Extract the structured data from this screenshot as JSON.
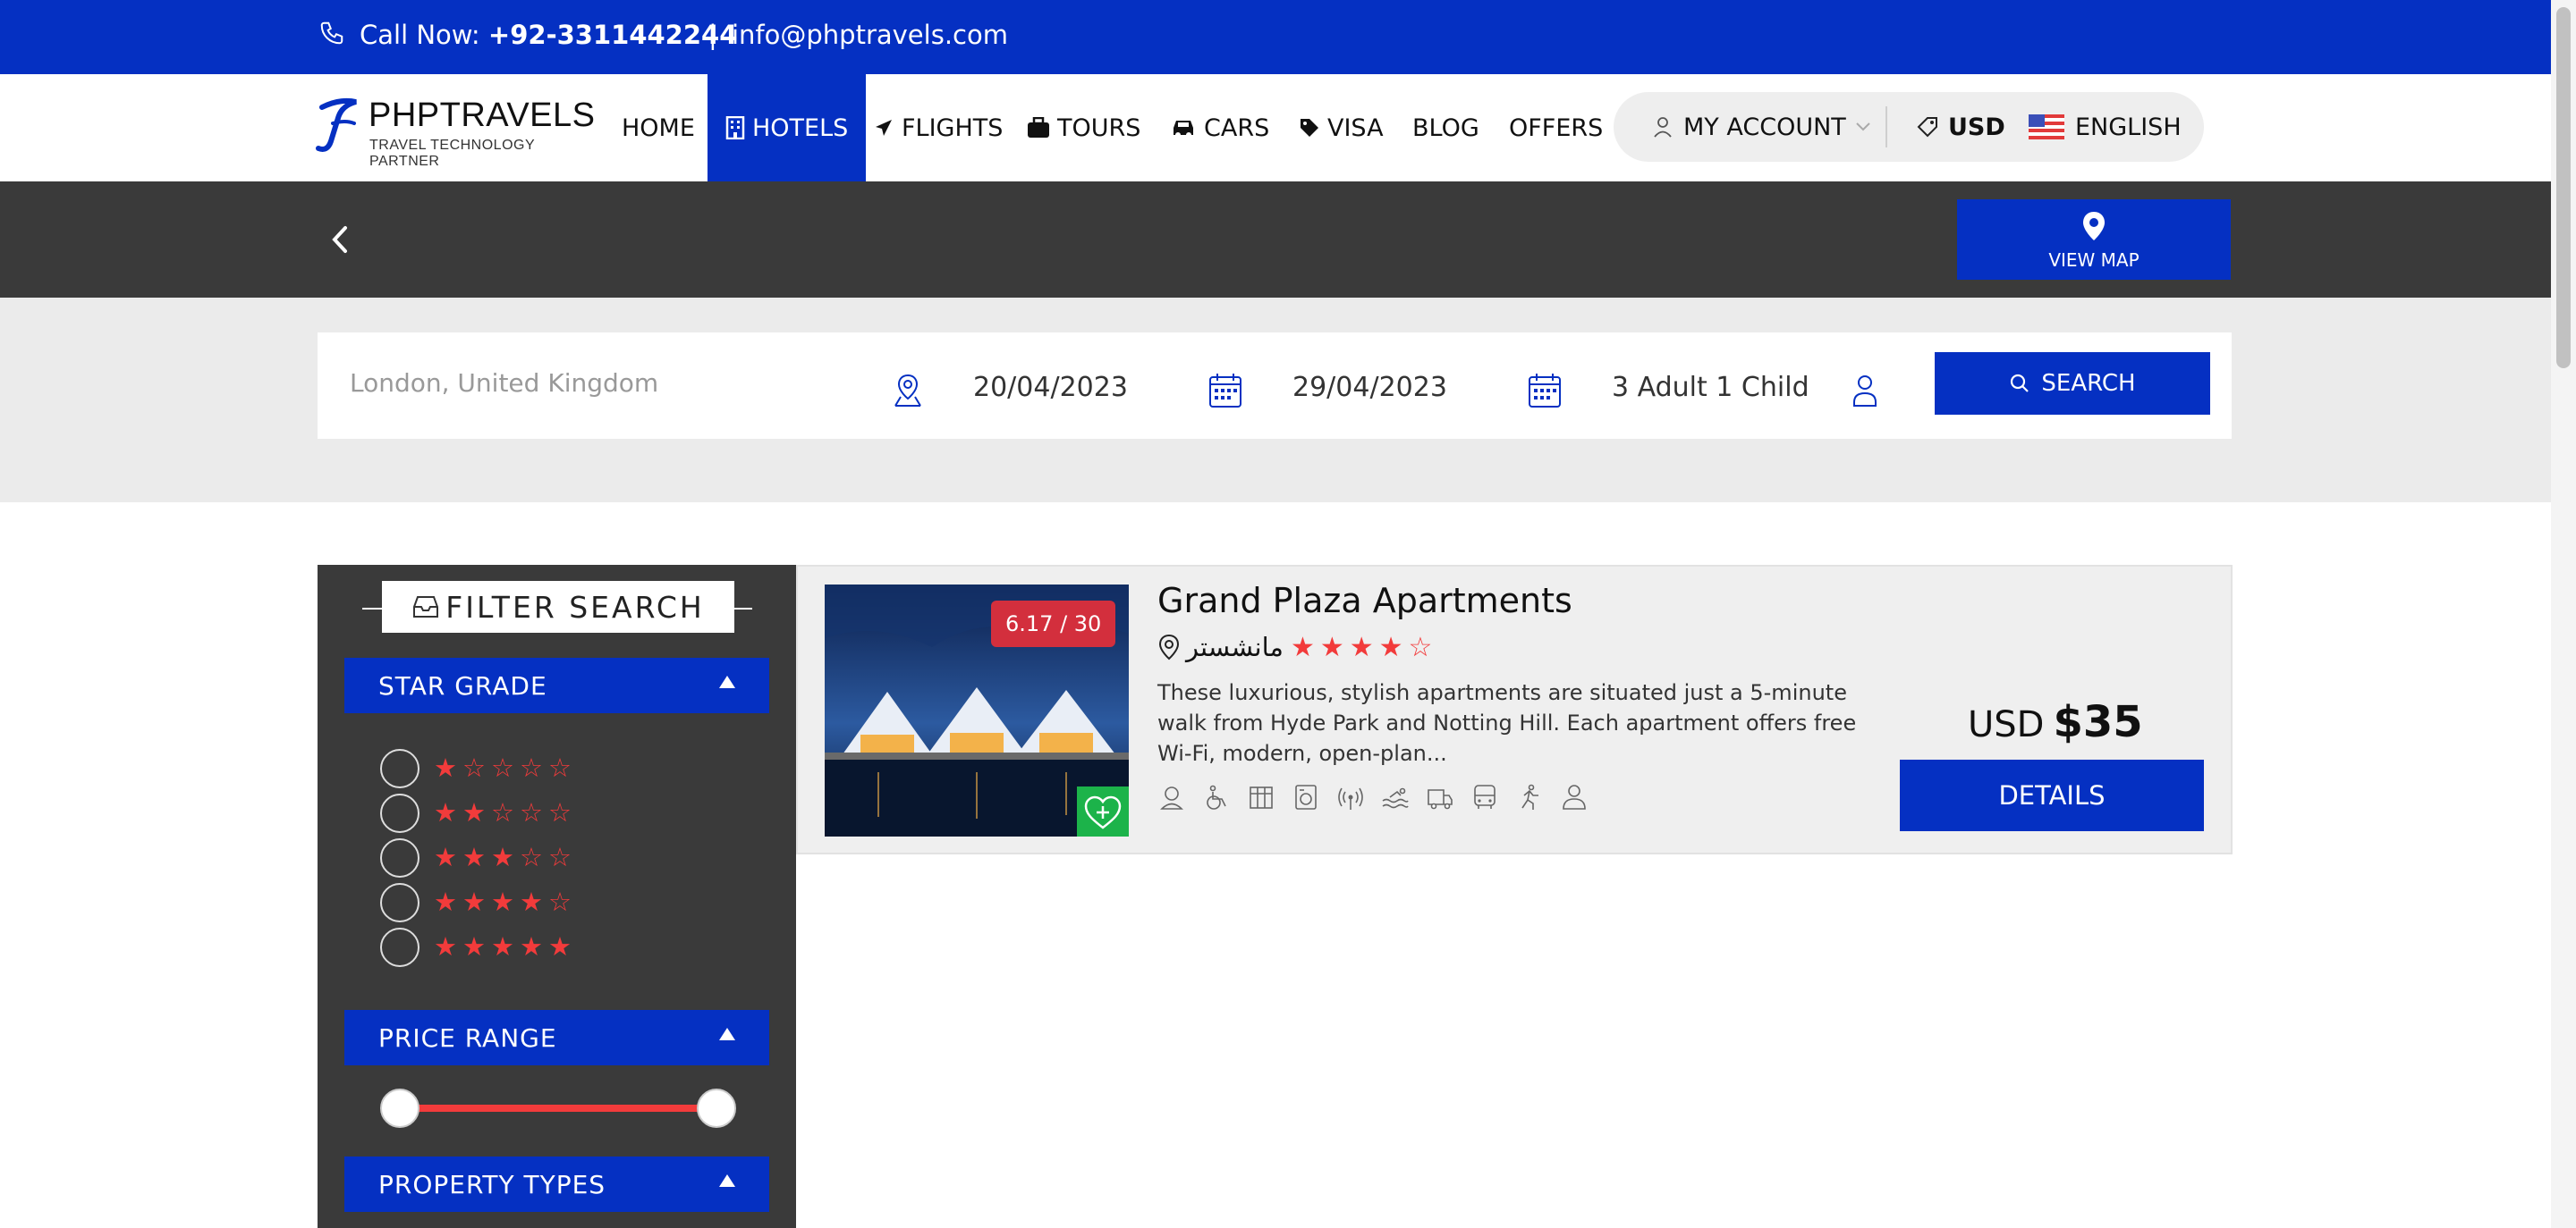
{
  "topbar": {
    "call_label": "Call Now:",
    "phone": "+92-3311442244",
    "separator": "|",
    "email": "info@phptravels.com"
  },
  "logo": {
    "name": "PHPTRAVELS",
    "tagline": "TRAVEL TECHNOLOGY PARTNER"
  },
  "nav": {
    "items": [
      {
        "label": "HOME",
        "icon": ""
      },
      {
        "label": "HOTELS",
        "icon": "building-icon",
        "active": true
      },
      {
        "label": "FLIGHTS",
        "icon": "plane-icon"
      },
      {
        "label": "TOURS",
        "icon": "suitcase-icon"
      },
      {
        "label": "CARS",
        "icon": "car-icon"
      },
      {
        "label": "VISA",
        "icon": "tag-icon"
      },
      {
        "label": "BLOG",
        "icon": ""
      },
      {
        "label": "OFFERS",
        "icon": ""
      }
    ],
    "account": "MY ACCOUNT",
    "currency": "USD",
    "language": "ENGLISH"
  },
  "header": {
    "view_map": "VIEW MAP"
  },
  "search": {
    "destination_placeholder": "London, United Kingdom",
    "checkin": "20/04/2023",
    "checkout": "29/04/2023",
    "guests": "3 Adult 1 Child",
    "button": "SEARCH"
  },
  "filters": {
    "title": "FILTER SEARCH",
    "star_grade": "STAR GRADE",
    "star_rows": [
      {
        "stars": "★☆☆☆☆"
      },
      {
        "stars": "★★☆☆☆"
      },
      {
        "stars": "★★★☆☆"
      },
      {
        "stars": "★★★★☆"
      },
      {
        "stars": "★★★★★"
      }
    ],
    "price_range": "PRICE RANGE",
    "price_range_fill": 1.0,
    "property_types": "PROPERTY TYPES"
  },
  "result": {
    "score": "6.17 / 30",
    "name": "Grand Plaza Apartments",
    "location": "مانشستر",
    "stars": "★★★★☆",
    "rating": 4,
    "description": "These luxurious, stylish apartments are situated just a 5-minute walk from Hyde Park and Notting Hill. Each apartment offers free Wi-Fi, modern, open-plan...",
    "currency": "USD",
    "price": "$35",
    "details_button": "DETAILS",
    "amenities": [
      "support-icon",
      "wheelchair-icon",
      "business-center-icon",
      "laundry-icon",
      "wifi-icon",
      "pool-icon",
      "shuttle-icon",
      "bus-icon",
      "fitness-icon",
      "reception-icon"
    ]
  },
  "colors": {
    "brand_blue": "#0530c2",
    "star_red": "#f23b3b",
    "score_red": "#d32f3d",
    "fav_green": "#1cb34a",
    "dark_band": "#3a3a3a"
  }
}
